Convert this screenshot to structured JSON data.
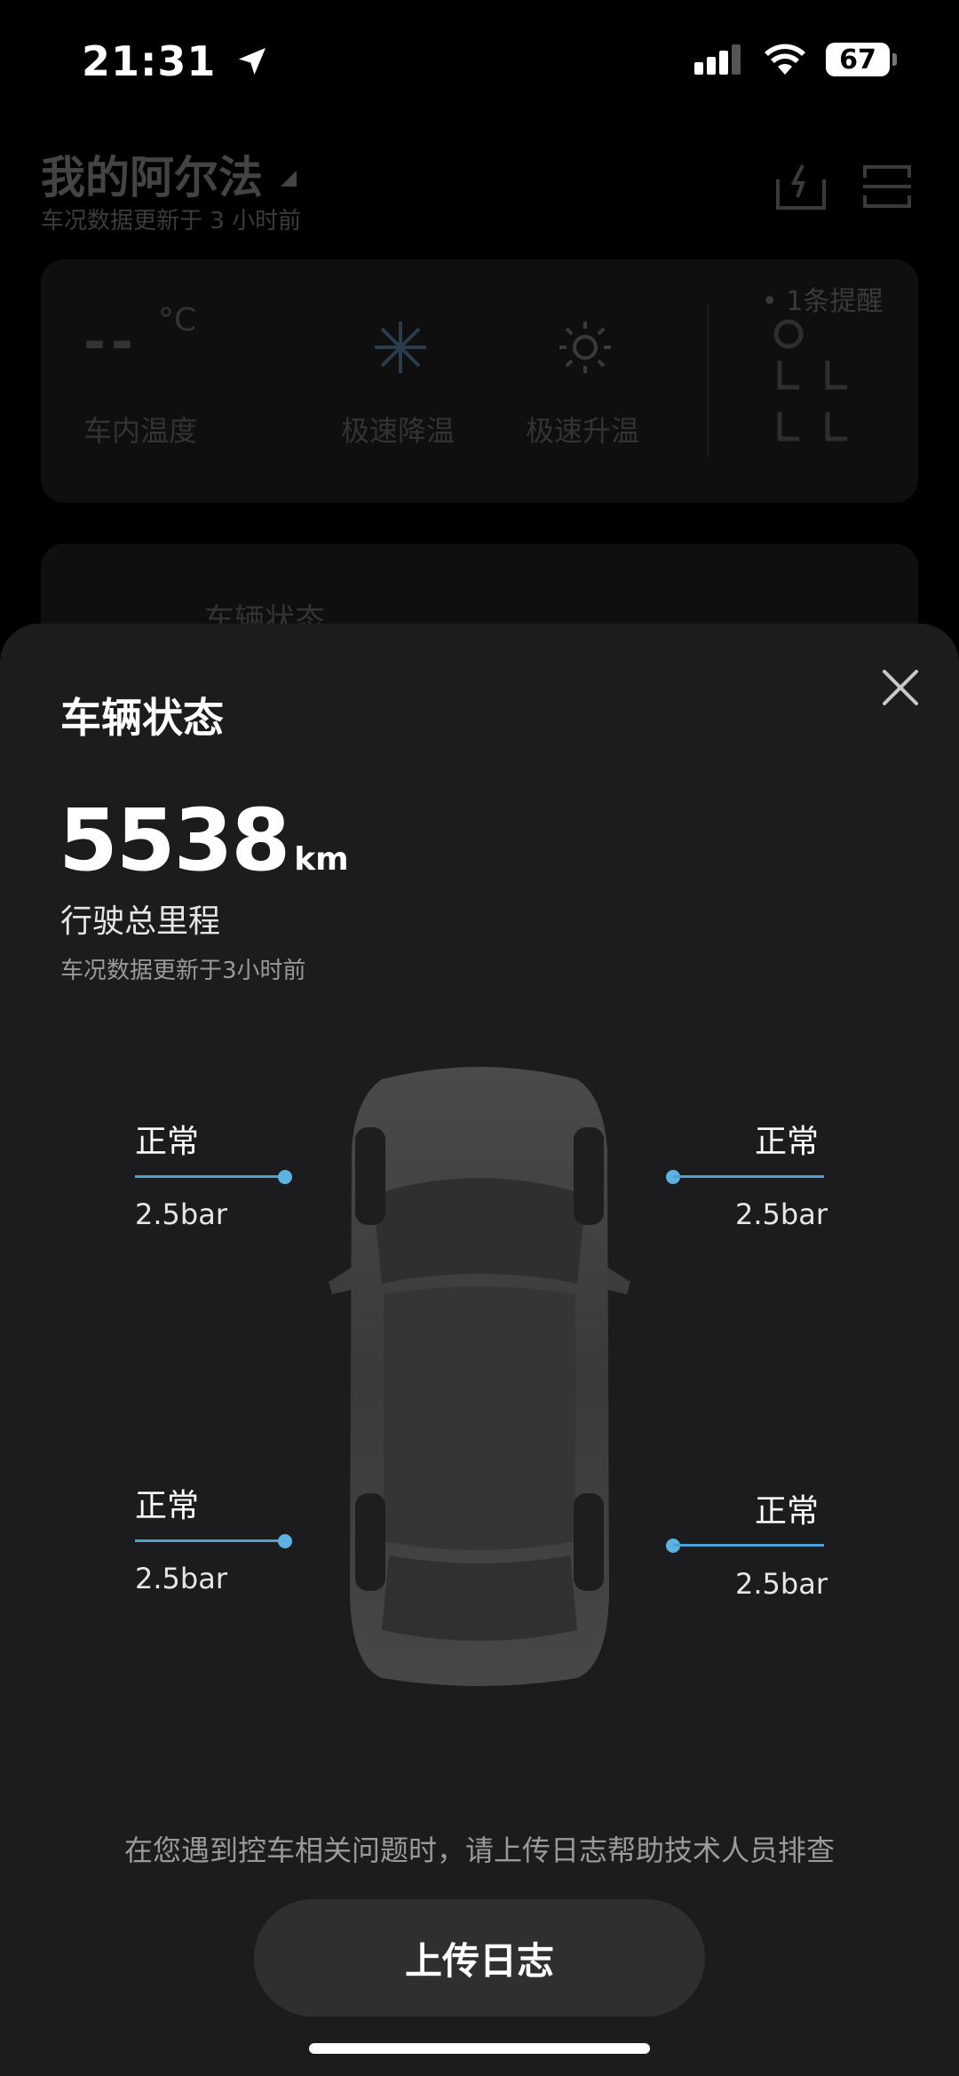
{
  "status_bar": {
    "time": "21:31",
    "battery": "67"
  },
  "background": {
    "title": "我的阿尔法",
    "subtitle": "车况数据更新于 3 小时前",
    "temp_value": "--",
    "temp_unit": "°C",
    "temp_label": "车内温度",
    "cool_label": "极速降温",
    "heat_label": "极速升温",
    "alert": "1条提醒",
    "card2_label": "车辆状态"
  },
  "sheet": {
    "title": "车辆状态",
    "mileage_value": "5538",
    "mileage_unit": "km",
    "mileage_label": "行驶总里程",
    "updated": "车况数据更新于3小时前",
    "tires": {
      "front_left": {
        "status": "正常",
        "pressure": "2.5bar"
      },
      "front_right": {
        "status": "正常",
        "pressure": "2.5bar"
      },
      "rear_left": {
        "status": "正常",
        "pressure": "2.5bar"
      },
      "rear_right": {
        "status": "正常",
        "pressure": "2.5bar"
      }
    },
    "hint": "在您遇到控车相关问题时，请上传日志帮助技术人员排查",
    "upload_button": "上传日志"
  },
  "colors": {
    "accent": "#5db2e0",
    "sheet_bg": "#1c1c1e",
    "button_bg": "#2f2f31"
  }
}
